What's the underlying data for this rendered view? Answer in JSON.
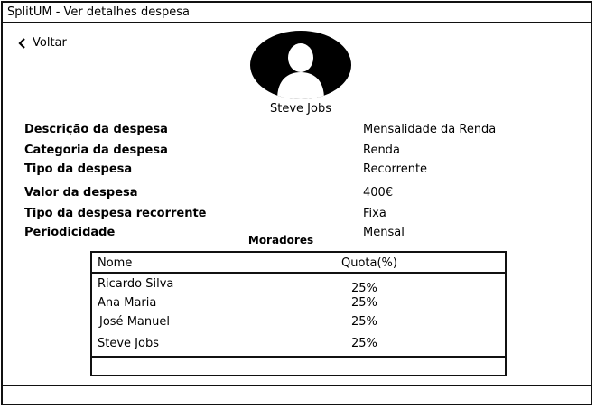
{
  "window": {
    "title": "SplitUM - Ver detalhes despesa"
  },
  "nav": {
    "back_label": "Voltar"
  },
  "user": {
    "name": "Steve Jobs",
    "avatar_icon": "user-silhouette-icon"
  },
  "fields": [
    {
      "label": "Descrição da despesa",
      "value": "Mensalidade da Renda"
    },
    {
      "label": "Categoria da despesa",
      "value": "Renda"
    },
    {
      "label": "Tipo da despesa",
      "value": "Recorrente"
    },
    {
      "label": "Valor da despesa",
      "value": "400€"
    },
    {
      "label": "Tipo da despesa recorrente",
      "value": "Fixa"
    },
    {
      "label": "Periodicidade",
      "value": "Mensal"
    }
  ],
  "residents": {
    "title": "Moradores",
    "headers": {
      "name": "Nome",
      "quota": "Quota(%)"
    },
    "rows": [
      {
        "name": "Ricardo Silva",
        "quota": "25%"
      },
      {
        "name": "Ana Maria",
        "quota": "25%"
      },
      {
        "name": "José Manuel",
        "quota": "25%"
      },
      {
        "name": "Steve Jobs",
        "quota": "25%"
      }
    ]
  }
}
